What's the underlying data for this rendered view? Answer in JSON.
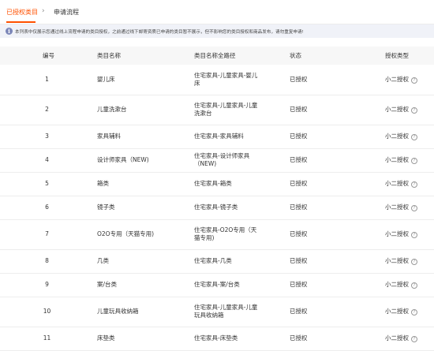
{
  "tabs": {
    "active_label": "已授权类目",
    "next_label": "申请流程",
    "separator": "›"
  },
  "notice": {
    "icon": "info-icon",
    "text": "本列表中仅展示您通过线上流程申请的类目授权，之前通过线下邮寄资质已申请的类目暂不展示，但不影响您的类目授权和商品发布，请勿重复申请!"
  },
  "table": {
    "columns": [
      "编号",
      "类目名称",
      "类目名称全路径",
      "状态",
      "授权类型"
    ],
    "rows": [
      {
        "no": "1",
        "name": "婴儿床",
        "path": "住宅家具-儿童家具-婴儿床",
        "status": "已授权",
        "type": "小二授权",
        "height": 38
      },
      {
        "no": "2",
        "name": "儿童洗漱台",
        "path": "住宅家具-儿童家具-儿童洗漱台",
        "status": "已授权",
        "type": "小二授权",
        "height": 38
      },
      {
        "no": "3",
        "name": "家具辅料",
        "path": "住宅家具-家具辅料",
        "status": "已授权",
        "type": "小二授权",
        "height": 30
      },
      {
        "no": "4",
        "name": "设计师家具（NEW)",
        "path": "住宅家具-设计师家具（NEW)",
        "status": "已授权",
        "type": "小二授权",
        "height": 30
      },
      {
        "no": "5",
        "name": "箱类",
        "path": "住宅家具-箱类",
        "status": "已授权",
        "type": "小二授权",
        "height": 30
      },
      {
        "no": "6",
        "name": "镜子类",
        "path": "住宅家具-镜子类",
        "status": "已授权",
        "type": "小二授权",
        "height": 30
      },
      {
        "no": "7",
        "name": "O2O专用（天猫专用)",
        "path": "住宅家具-O2O专用（天猫专用)",
        "status": "已授权",
        "type": "小二授权",
        "height": 38
      },
      {
        "no": "8",
        "name": "几类",
        "path": "住宅家具-几类",
        "status": "已授权",
        "type": "小二授权",
        "height": 30
      },
      {
        "no": "9",
        "name": "案/台类",
        "path": "住宅家具-案/台类",
        "status": "已授权",
        "type": "小二授权",
        "height": 30
      },
      {
        "no": "10",
        "name": "儿童玩具收纳箱",
        "path": "住宅家具-儿童家具-儿童玩具收纳箱",
        "status": "已授权",
        "type": "小二授权",
        "height": 38
      },
      {
        "no": "11",
        "name": "床垫类",
        "path": "住宅家具-床垫类",
        "status": "已授权",
        "type": "小二授权",
        "height": 30
      }
    ]
  },
  "colors": {
    "accent": "#ff5000",
    "header_bg": "#f7f7f7",
    "notice_bg": "#f0f2f8"
  }
}
